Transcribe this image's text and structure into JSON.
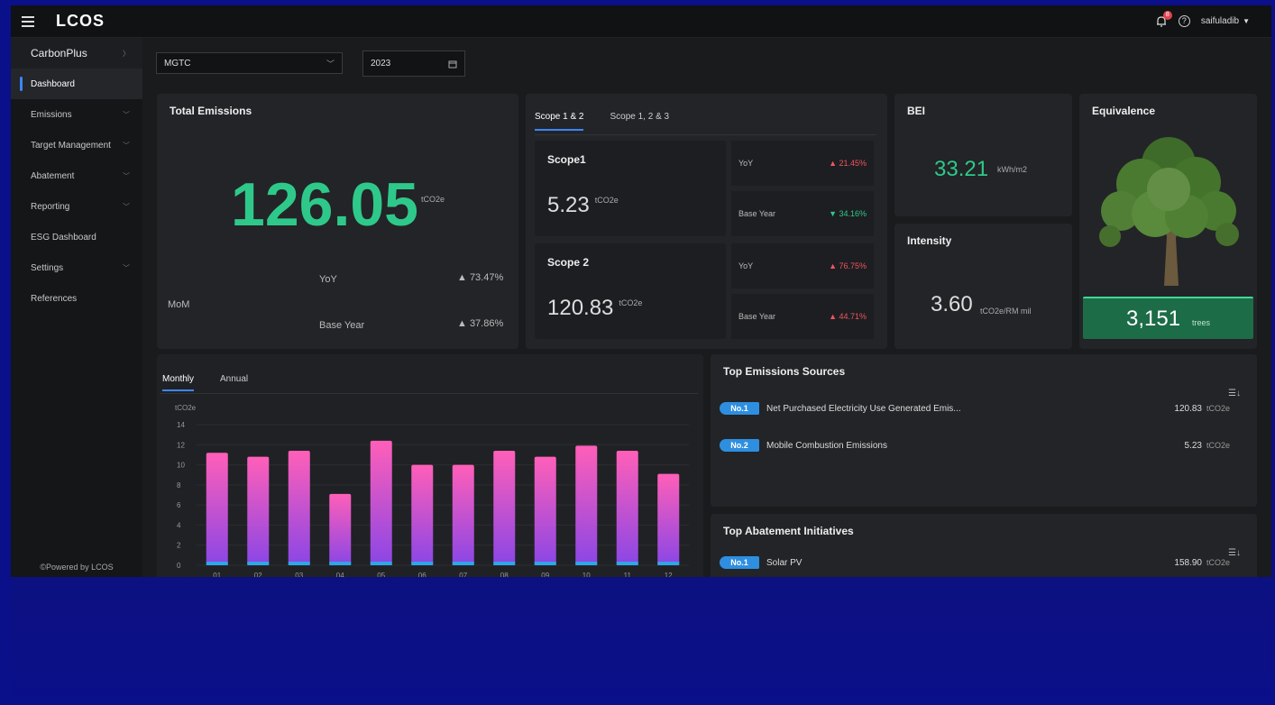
{
  "app": {
    "logo": "LCOS",
    "user": "saifuladib",
    "notifications": "8"
  },
  "sidebar": {
    "brand": "CarbonPlus",
    "items": [
      {
        "label": "Dashboard",
        "active": true,
        "chevron": false
      },
      {
        "label": "Emissions",
        "chevron": true
      },
      {
        "label": "Target Management",
        "chevron": true
      },
      {
        "label": "Abatement",
        "chevron": true
      },
      {
        "label": "Reporting",
        "chevron": true
      },
      {
        "label": "ESG Dashboard",
        "chevron": false
      },
      {
        "label": "Settings",
        "chevron": true
      },
      {
        "label": "References",
        "chevron": false
      }
    ],
    "powered": "©Powered by LCOS"
  },
  "filters": {
    "company": "MGTC",
    "year": "2023"
  },
  "total": {
    "title": "Total Emissions",
    "value": "126.05",
    "unit": "tCO2e",
    "mom_label": "MoM",
    "yoy_label": "YoY",
    "yoy": "▲ 73.47%",
    "base_label": "Base Year",
    "base": "▲ 37.86%"
  },
  "scopes": {
    "tabs": [
      "Scope 1 & 2",
      "Scope 1, 2 & 3"
    ],
    "scope1": {
      "title": "Scope1",
      "value": "5.23",
      "unit": "tCO2e",
      "yoy_label": "YoY",
      "yoy": "▲ 21.45%",
      "base_label": "Base Year",
      "base": "▼ 34.16%"
    },
    "scope2": {
      "title": "Scope 2",
      "value": "120.83",
      "unit": "tCO2e",
      "yoy_label": "YoY",
      "yoy": "▲ 76.75%",
      "base_label": "Base Year",
      "base": "▲ 44.71%"
    }
  },
  "bei": {
    "title": "BEI",
    "value": "33.21",
    "unit": "kWh/m2"
  },
  "intensity": {
    "title": "Intensity",
    "value": "3.60",
    "unit": "tCO2e/RM mil"
  },
  "equivalence": {
    "title": "Equivalence",
    "value": "3,151",
    "unit": "trees"
  },
  "chart": {
    "tabs": [
      "Monthly",
      "Annual"
    ]
  },
  "chart_data": {
    "type": "bar",
    "ylabel": "tCO2e",
    "ylim": [
      0,
      14
    ],
    "yticks": [
      0,
      2,
      4,
      6,
      8,
      10,
      12,
      14
    ],
    "categories": [
      "01",
      "02",
      "03",
      "04",
      "05",
      "06",
      "07",
      "08",
      "09",
      "10",
      "11",
      "12"
    ],
    "values": [
      11.2,
      10.8,
      11.4,
      7.1,
      12.4,
      10.0,
      10.0,
      11.4,
      10.8,
      11.9,
      11.4,
      9.1
    ],
    "grid": true,
    "colors": {
      "top": "#ff5fb8",
      "bottom": "#8a46e6",
      "base": "#2ea6e8"
    }
  },
  "sources": {
    "title": "Top Emissions Sources",
    "items": [
      {
        "rank": "No.1",
        "name": "Net Purchased Electricity Use Generated Emis...",
        "value": "120.83",
        "unit": "tCO2e"
      },
      {
        "rank": "No.2",
        "name": "Mobile Combustion Emissions",
        "value": "5.23",
        "unit": "tCO2e"
      }
    ]
  },
  "abatement": {
    "title": "Top Abatement Initiatives",
    "items": [
      {
        "rank": "No.1",
        "name": "Solar PV",
        "value": "158.90",
        "unit": "tCO2e"
      }
    ]
  }
}
